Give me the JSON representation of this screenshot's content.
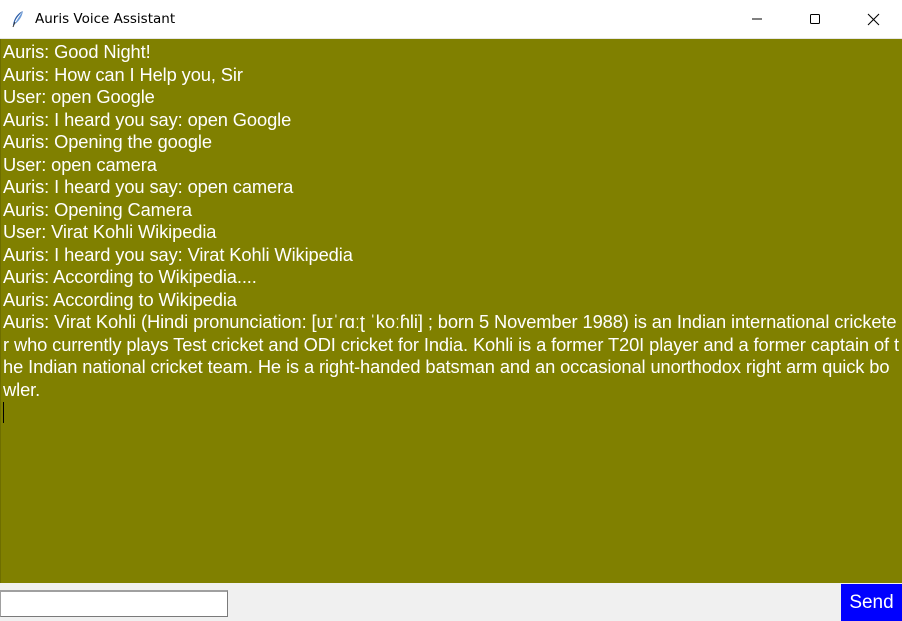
{
  "window": {
    "title": "Auris Voice Assistant",
    "icon": "feather-icon",
    "controls": {
      "minimize_icon": "minimize-icon",
      "maximize_icon": "maximize-icon",
      "close_icon": "close-icon"
    }
  },
  "chat": {
    "background_color": "#808000",
    "text_color": "#ffffff",
    "lines": [
      "Auris: Good Night!",
      "Auris: How can I Help you, Sir",
      "User: open Google",
      "Auris: I heard you say: open Google",
      "Auris: Opening the google",
      "User: open camera",
      "Auris: I heard you say: open camera",
      "Auris: Opening Camera",
      "User: Virat Kohli Wikipedia",
      "Auris: I heard you say: Virat Kohli Wikipedia",
      "Auris: According to Wikipedia....",
      "Auris: According to Wikipedia",
      "Auris: Virat Kohli (Hindi pronunciation: [ʋɪˈɾɑːʈ ˈkoːɦli] ; born 5 November 1988) is an Indian international cricketer who currently plays Test cricket and ODI cricket for India. Kohli is a former T20I player and a former captain of the Indian national cricket team. He is a right-handed batsman and an occasional unorthodox right arm quick bowler."
    ]
  },
  "input_bar": {
    "message_value": "",
    "send_label": "Send",
    "send_color": "#0000ff"
  }
}
